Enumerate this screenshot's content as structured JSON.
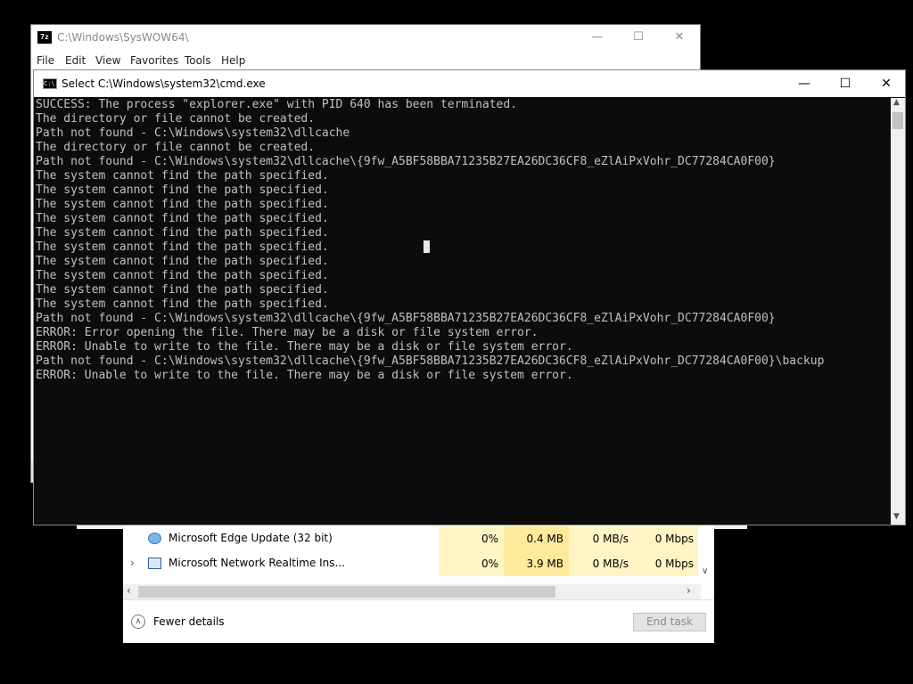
{
  "sevenzip": {
    "title": "C:\\Windows\\SysWOW64\\",
    "icon_text": "7z",
    "menu": [
      "File",
      "Edit",
      "View",
      "Favorites",
      "Tools",
      "Help"
    ],
    "minimize": "—",
    "maximize": "☐",
    "close": "✕"
  },
  "taskmgr": {
    "rows": [
      {
        "name": "Microsoft Edge Update (32 bit)",
        "cpu": "0%",
        "memory": "0.4 MB",
        "disk": "0 MB/s",
        "network": "0 Mbps",
        "expandable": false
      },
      {
        "name": "Microsoft Network Realtime Ins...",
        "cpu": "0%",
        "memory": "3.9 MB",
        "disk": "0 MB/s",
        "network": "0 Mbps",
        "expandable": true
      }
    ],
    "fewer_details": "Fewer details",
    "end_task": "End task"
  },
  "cmd": {
    "title": "Select C:\\Windows\\system32\\cmd.exe",
    "icon_text": "C:\\",
    "minimize": "—",
    "maximize": "☐",
    "close": "✕",
    "lines": [
      "SUCCESS: The process \"explorer.exe\" with PID 640 has been terminated.",
      "The directory or file cannot be created.",
      "Path not found - C:\\Windows\\system32\\dllcache",
      "The directory or file cannot be created.",
      "Path not found - C:\\Windows\\system32\\dllcache\\{9fw_A5BF58BBA71235B27EA26DC36CF8_eZlAiPxVohr_DC77284CA0F00}",
      "The system cannot find the path specified.",
      "The system cannot find the path specified.",
      "The system cannot find the path specified.",
      "The system cannot find the path specified.",
      "The system cannot find the path specified.",
      "The system cannot find the path specified.",
      "The system cannot find the path specified.",
      "The system cannot find the path specified.",
      "The system cannot find the path specified.",
      "The system cannot find the path specified.",
      "Path not found - C:\\Windows\\system32\\dllcache\\{9fw_A5BF58BBA71235B27EA26DC36CF8_eZlAiPxVohr_DC77284CA0F00}",
      "ERROR: Error opening the file. There may be a disk or file system error.",
      "ERROR: Unable to write to the file. There may be a disk or file system error.",
      "Path not found - C:\\Windows\\system32\\dllcache\\{9fw_A5BF58BBA71235B27EA26DC36CF8_eZlAiPxVohr_DC77284CA0F00}\\backup",
      "ERROR: Unable to write to the file. There may be a disk or file system error."
    ]
  }
}
